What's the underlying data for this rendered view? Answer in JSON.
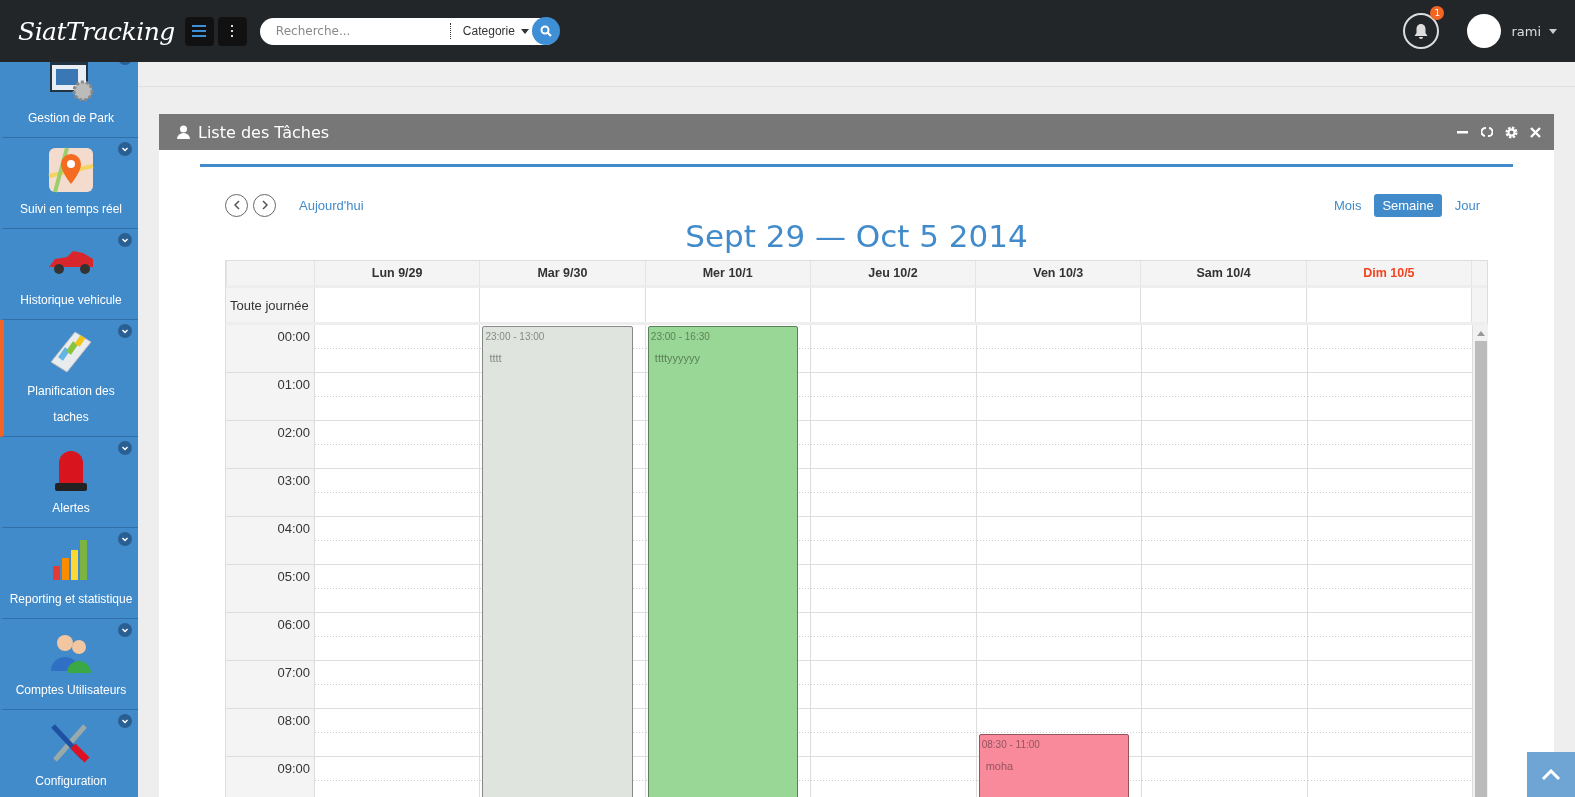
{
  "topbar": {
    "logo": "SiatTracking",
    "search": {
      "placeholder": "Recherche..."
    },
    "category": "Categorie",
    "notifications": {
      "count": "1"
    },
    "user": {
      "name": "rami"
    }
  },
  "sidebar": {
    "items": [
      {
        "label": "Gestion de Park",
        "kind": "park",
        "selected": false
      },
      {
        "label": "Suivi en temps réel",
        "kind": "map",
        "selected": false
      },
      {
        "label": "Historique vehicule",
        "kind": "car",
        "selected": false
      },
      {
        "label": "Planification des taches",
        "kind": "planning",
        "selected": true
      },
      {
        "label": "Alertes",
        "kind": "alert",
        "selected": false
      },
      {
        "label": "Reporting et statistique",
        "kind": "chart",
        "selected": false
      },
      {
        "label": "Comptes Utilisateurs",
        "kind": "users",
        "selected": false
      },
      {
        "label": "Configuration",
        "kind": "config",
        "selected": false
      }
    ]
  },
  "panel": {
    "title": "Liste des Tâches"
  },
  "calendar": {
    "today_button": "Aujourd'hui",
    "views": [
      {
        "label": "Mois",
        "selected": false
      },
      {
        "label": "Semaine",
        "selected": true
      },
      {
        "label": "Jour",
        "selected": false
      }
    ],
    "title": "Sept 29 — Oct 5 2014",
    "allday_label": "Toute journée",
    "hours": [
      "00:00",
      "01:00",
      "02:00",
      "03:00",
      "04:00",
      "05:00",
      "06:00",
      "07:00",
      "08:00",
      "09:00"
    ],
    "days": [
      {
        "label": "Lun 9/29",
        "highlighted": false
      },
      {
        "label": "Mar 9/30",
        "highlighted": false,
        "events": [
          {
            "time": "23:00 - 13:00",
            "title": "tttt",
            "color": "#dfe5de"
          }
        ]
      },
      {
        "label": "Mer 10/1",
        "highlighted": false,
        "events": [
          {
            "time": "23:00 - 16:30",
            "title": "ttttyyyyyy",
            "color": "#99d796"
          }
        ]
      },
      {
        "label": "Jeu 10/2",
        "highlighted": false
      },
      {
        "label": "Ven 10/3",
        "highlighted": false,
        "events": [
          {
            "time": "08:30 - 11:00",
            "title": "moha",
            "color": "#f98a9c"
          }
        ]
      },
      {
        "label": "Sam 10/4",
        "highlighted": false
      },
      {
        "label": "Dim 10/5",
        "highlighted": true
      }
    ]
  }
}
